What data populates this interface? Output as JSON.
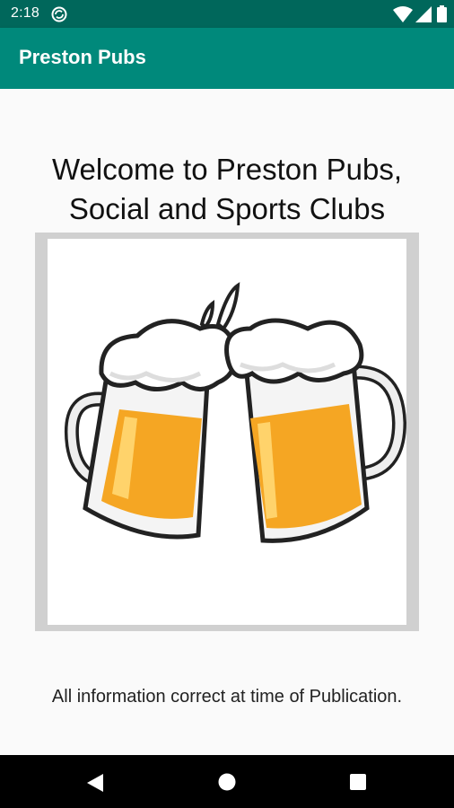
{
  "status_bar": {
    "time": "2:18",
    "icons": [
      "sync-icon",
      "wifi-icon",
      "signal-icon",
      "battery-icon"
    ]
  },
  "app_bar": {
    "title": "Preston Pubs",
    "color": "#00897b"
  },
  "main": {
    "welcome_line1": "Welcome to Preston Pubs,",
    "welcome_line2": "Social and Sports Clubs",
    "image": "beer-mugs-cheers-illustration",
    "disclaimer": "All information correct at time of Publication."
  },
  "nav_bar": {
    "icons": [
      "back-icon",
      "home-icon",
      "recents-icon"
    ]
  },
  "colors": {
    "status_bar": "#00675b",
    "accent": "#00897b",
    "beer": "#f5a623"
  }
}
